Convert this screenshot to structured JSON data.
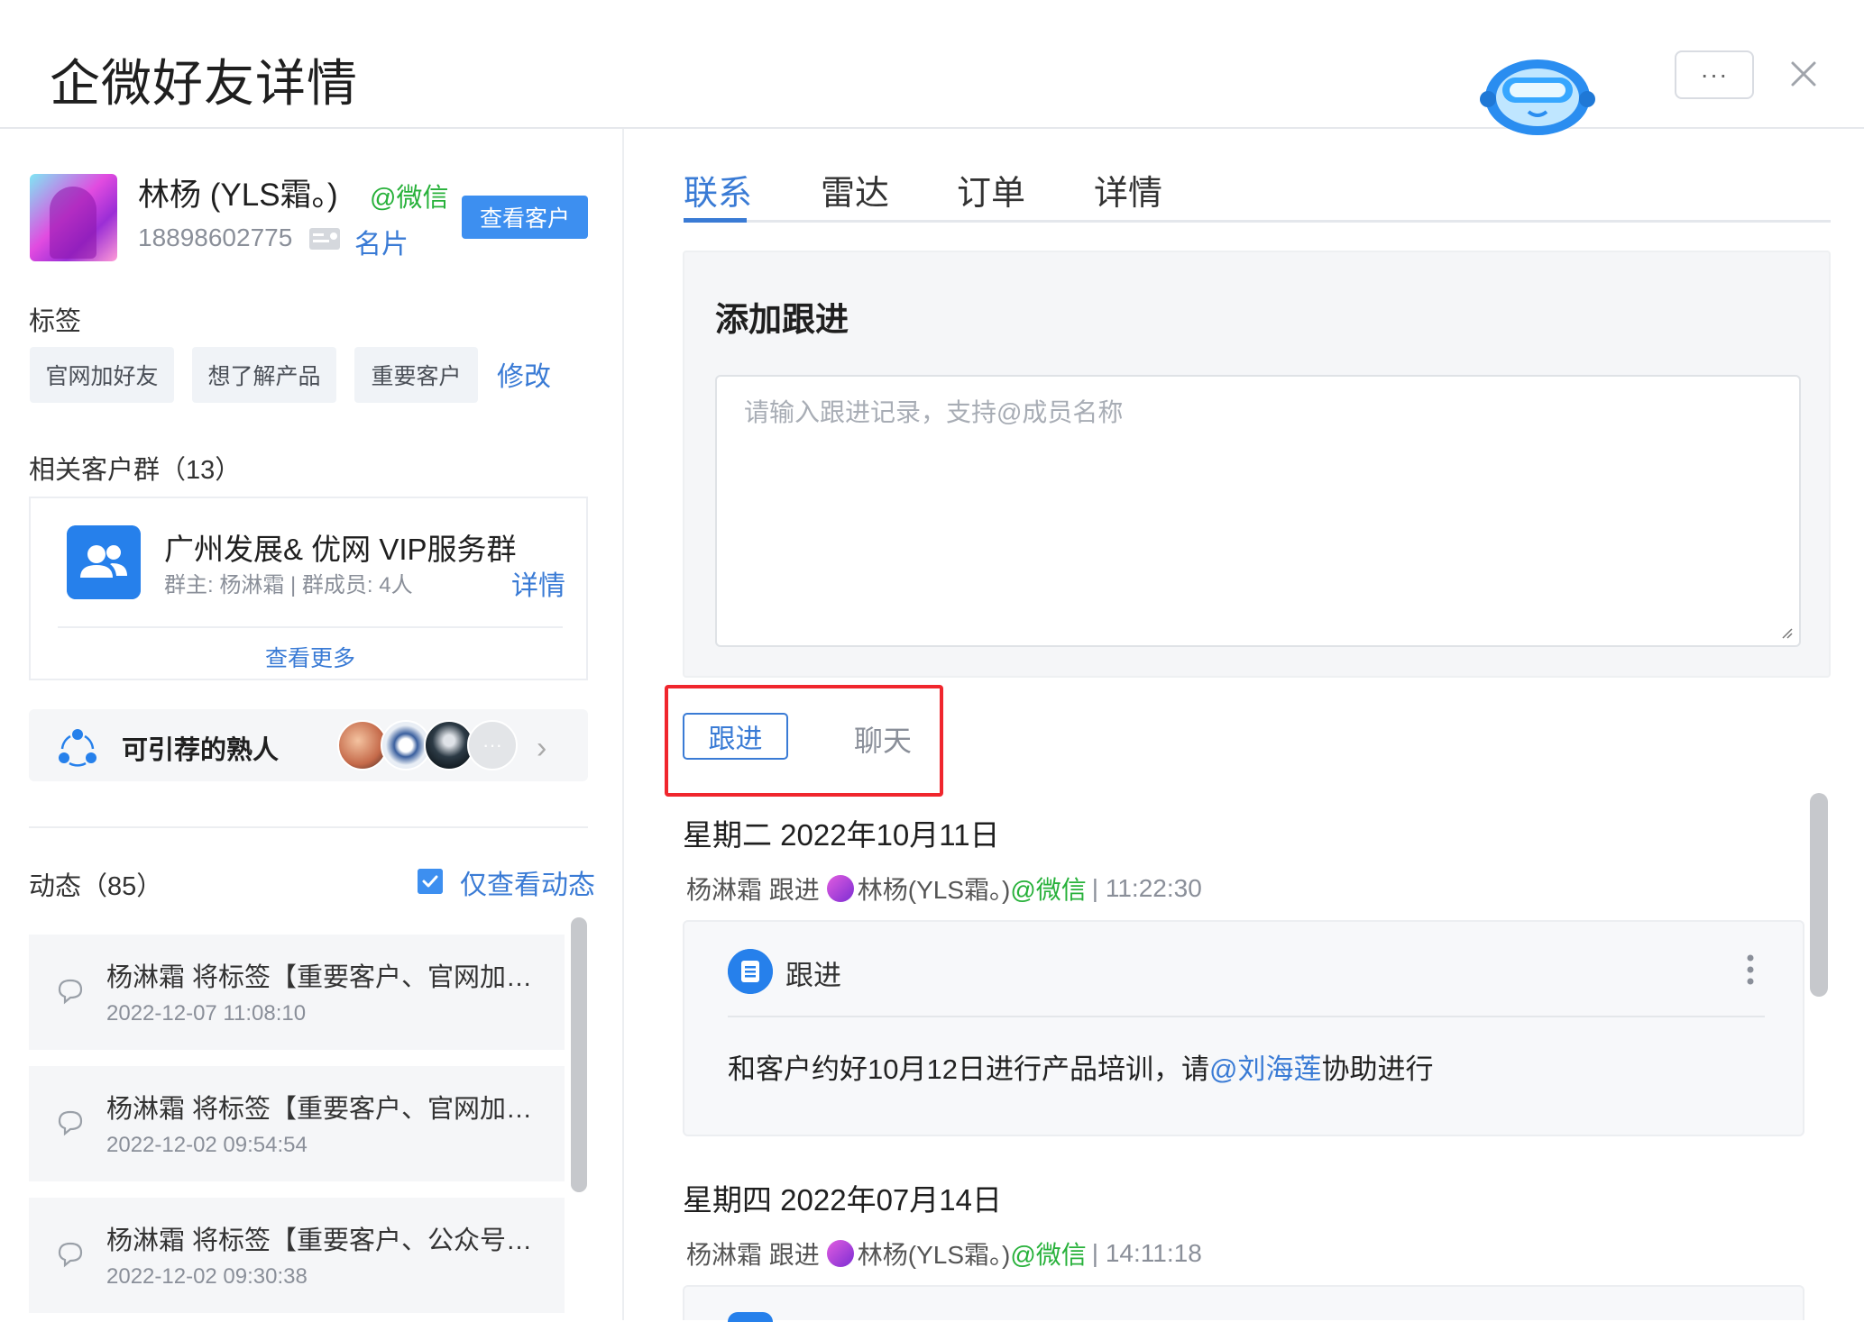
{
  "header": {
    "title": "企微好友详情",
    "more_label": "···"
  },
  "profile": {
    "name": "林杨 (YLS霜。)",
    "wechat_tag": "@微信",
    "phone": "18898602775",
    "card_label": "名片",
    "view_customer_label": "查看客户"
  },
  "tags": {
    "title": "标签",
    "items": [
      "官网加好友",
      "想了解产品",
      "重要客户"
    ],
    "edit_label": "修改"
  },
  "groups": {
    "title": "相关客户群（13）",
    "item": {
      "name": "广州发展& 优网 VIP服务群",
      "meta": "群主: 杨淋霜 | 群成员: 4人",
      "detail_label": "详情"
    },
    "view_more_label": "查看更多"
  },
  "referral": {
    "label": "可引荐的熟人",
    "more_label": "···"
  },
  "feed": {
    "title": "动态（85）",
    "only_label": "仅查看动态",
    "only_checked": true,
    "items": [
      {
        "text": "杨淋霜 将标签【重要客户、官网加…",
        "time": "2022-12-07 11:08:10"
      },
      {
        "text": "杨淋霜 将标签【重要客户、官网加…",
        "time": "2022-12-02 09:54:54"
      },
      {
        "text": "杨淋霜 将标签【重要客户、公众号…",
        "time": "2022-12-02 09:30:38"
      }
    ]
  },
  "tabs": {
    "items": [
      "联系",
      "雷达",
      "订单",
      "详情"
    ],
    "active": "联系"
  },
  "add_followup": {
    "title": "添加跟进",
    "placeholder": "请输入跟进记录，支持@成员名称"
  },
  "filter": {
    "follow_label": "跟进",
    "chat_label": "聊天"
  },
  "records": [
    {
      "date": "星期二   2022年10月11日",
      "author": "杨淋霜 跟进",
      "contact": "林杨(YLS霜。)",
      "wechat": "@微信",
      "time": "| 11:22:30",
      "type_label": "跟进",
      "content_before": "和客户约好10月12日进行产品培训，请",
      "mention": "@刘海莲",
      "content_after": "协助进行"
    },
    {
      "date": "星期四   2022年07月14日",
      "author": "杨淋霜 跟进",
      "contact": "林杨(YLS霜。)",
      "wechat": "@微信",
      "time": "| 14:11:18"
    }
  ],
  "colors": {
    "accent": "#3a7bd5",
    "wechat_green": "#27b13a",
    "highlight_red": "#f0262d"
  }
}
